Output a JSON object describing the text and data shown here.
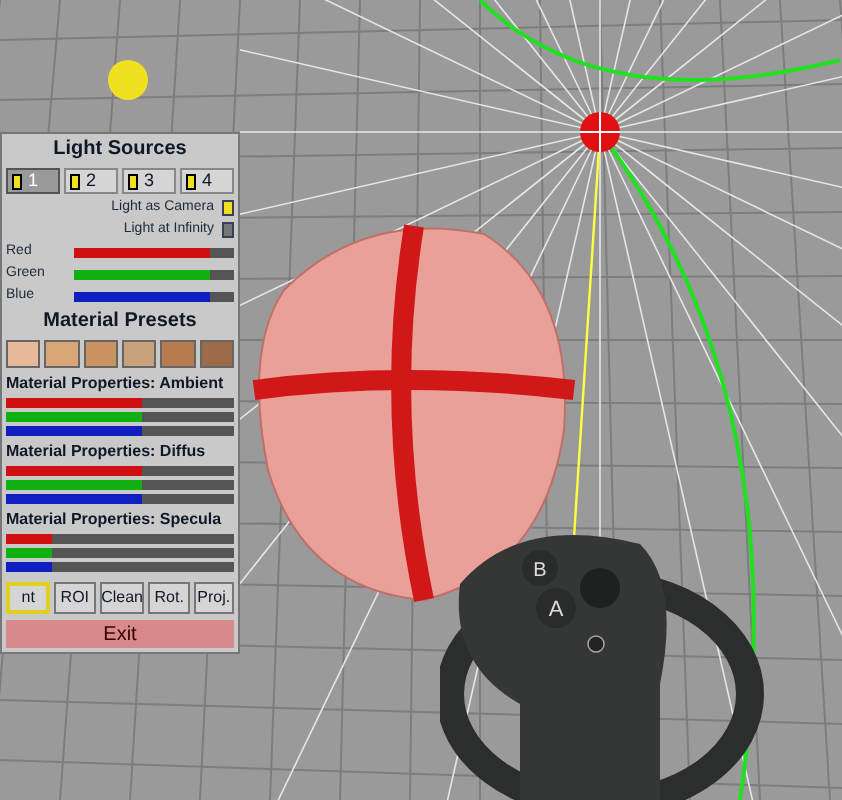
{
  "light_sources": {
    "title": "Light Sources",
    "tabs": [
      {
        "label": "1",
        "selected": true
      },
      {
        "label": "2",
        "selected": false
      },
      {
        "label": "3",
        "selected": false
      },
      {
        "label": "4",
        "selected": false
      }
    ],
    "toggles": [
      {
        "label": "Light as Camera",
        "checked": true
      },
      {
        "label": "Light at Infinity",
        "checked": false
      }
    ],
    "sliders": [
      {
        "label": "Red",
        "color": "#d01010",
        "level": 0.85
      },
      {
        "label": "Green",
        "color": "#10b010",
        "level": 0.85
      },
      {
        "label": "Blue",
        "color": "#1020c0",
        "level": 0.85
      }
    ]
  },
  "material_presets": {
    "title": "Material Presets",
    "swatches": [
      {
        "color": "#e8b89a"
      },
      {
        "color": "#d9a679"
      },
      {
        "color": "#c99460"
      },
      {
        "color": "#c8a27c"
      },
      {
        "color": "#b87a4e"
      },
      {
        "color": "#9b6b4a"
      }
    ]
  },
  "material_sections": [
    {
      "title": "Material Properties: Ambient",
      "sliders": [
        {
          "color": "#d01010",
          "level": 0.6
        },
        {
          "color": "#10b010",
          "level": 0.6
        },
        {
          "color": "#1020c0",
          "level": 0.6
        }
      ]
    },
    {
      "title": "Material Properties: Diffus",
      "sliders": [
        {
          "color": "#d01010",
          "level": 0.6
        },
        {
          "color": "#10b010",
          "level": 0.6
        },
        {
          "color": "#1020c0",
          "level": 0.6
        }
      ]
    },
    {
      "title": "Material Properties: Specula",
      "sliders": [
        {
          "color": "#d01010",
          "level": 0.2
        },
        {
          "color": "#10b010",
          "level": 0.2
        },
        {
          "color": "#1020c0",
          "level": 0.2
        }
      ]
    }
  ],
  "tool_buttons": [
    {
      "label": "nt",
      "selected": true
    },
    {
      "label": "ROI",
      "selected": false
    },
    {
      "label": "Clean",
      "selected": false
    },
    {
      "label": "Rot.",
      "selected": false
    },
    {
      "label": "Proj.",
      "selected": false
    }
  ],
  "exit_button": "Exit",
  "controller": {
    "buttons": [
      "B",
      "A"
    ]
  }
}
